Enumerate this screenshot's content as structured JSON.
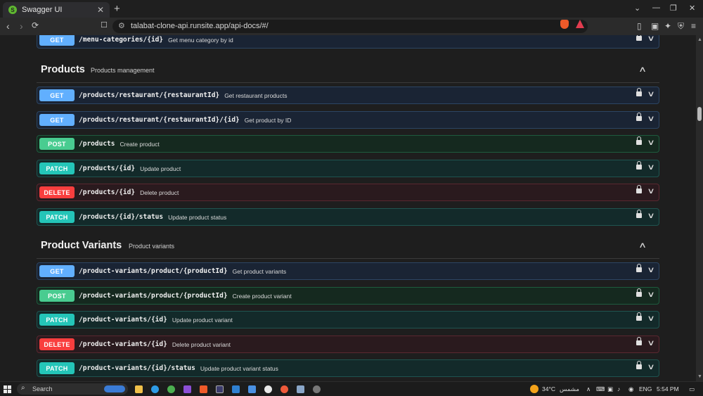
{
  "browser": {
    "tab_title": "Swagger UI",
    "tab_favicon_letter": "S",
    "close_symbol": "✕",
    "new_tab_symbol": "+",
    "url": "talabat-clone-api.runsite.app/api-docs/#/",
    "window_controls": [
      "⌄",
      "—",
      "❐",
      "✕"
    ]
  },
  "sections": [
    {
      "endpoints": [
        {
          "method": "GET",
          "path": "/menu-categories/{id}",
          "summary": "Get menu category by id"
        }
      ]
    },
    {
      "title": "Products",
      "description": "Products management",
      "endpoints": [
        {
          "method": "GET",
          "path": "/products/restaurant/{restaurantId}",
          "summary": "Get restaurant products"
        },
        {
          "method": "GET",
          "path": "/products/restaurant/{restaurantId}/{id}",
          "summary": "Get product by ID"
        },
        {
          "method": "POST",
          "path": "/products",
          "summary": "Create product"
        },
        {
          "method": "PATCH",
          "path": "/products/{id}",
          "summary": "Update product"
        },
        {
          "method": "DELETE",
          "path": "/products/{id}",
          "summary": "Delete product"
        },
        {
          "method": "PATCH",
          "path": "/products/{id}/status",
          "summary": "Update product status"
        }
      ]
    },
    {
      "title": "Product Variants",
      "description": "Product variants",
      "endpoints": [
        {
          "method": "GET",
          "path": "/product-variants/product/{productId}",
          "summary": "Get product variants"
        },
        {
          "method": "POST",
          "path": "/product-variants/product/{productId}",
          "summary": "Create product variant"
        },
        {
          "method": "PATCH",
          "path": "/product-variants/{id}",
          "summary": "Update product variant"
        },
        {
          "method": "DELETE",
          "path": "/product-variants/{id}",
          "summary": "Delete product variant"
        },
        {
          "method": "PATCH",
          "path": "/product-variants/{id}/status",
          "summary": "Update product variant status"
        }
      ]
    }
  ],
  "taskbar": {
    "search_label": "Search",
    "temperature": "34°C",
    "weather_text": "مشمس",
    "language": "ENG",
    "time": "5:54 PM"
  },
  "colors": {
    "get": "#61affe",
    "post": "#49cc90",
    "patch": "#24c5b8",
    "delete": "#f93e3e"
  }
}
